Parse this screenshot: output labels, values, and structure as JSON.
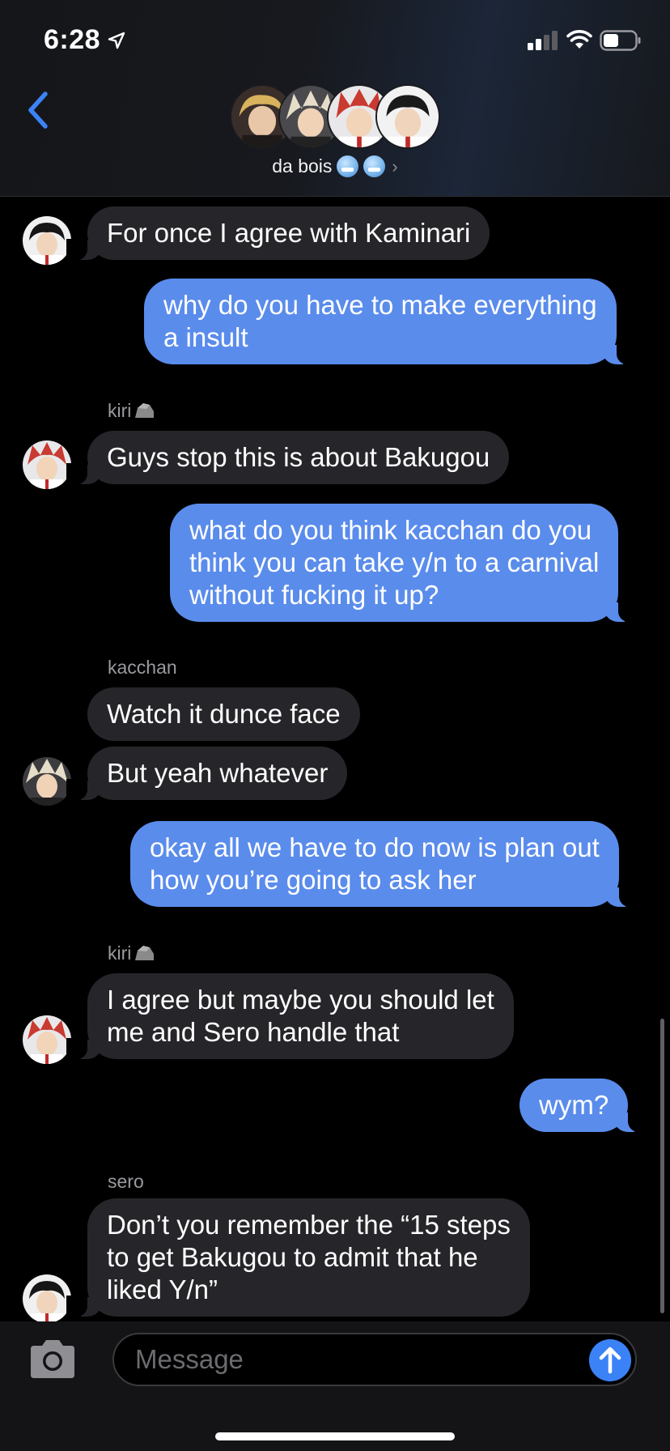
{
  "status_bar": {
    "time": "6:28"
  },
  "header": {
    "group_name": "da bois",
    "avatars": [
      "denki-avatar",
      "bakugou-avatar",
      "kirishima-avatar",
      "sero-avatar"
    ]
  },
  "messages": [
    {
      "id": "m1",
      "direction": "incoming",
      "sender": "",
      "text": "For once I agree with Kaminari",
      "avatar": "sero"
    },
    {
      "id": "m2",
      "direction": "outgoing",
      "lines": [
        "why do you have to make everything",
        "a insult"
      ]
    },
    {
      "id": "m3",
      "direction": "incoming",
      "sender": "kiri",
      "text": "Guys stop this is about Bakugou",
      "avatar": "kirishima"
    },
    {
      "id": "m4",
      "direction": "outgoing",
      "lines": [
        "what do you think kacchan do you",
        "think you can take y/n to a carnival",
        "without fucking it up?"
      ]
    },
    {
      "id": "m5",
      "direction": "incoming",
      "sender": "kacchan",
      "text": "Watch it dunce face"
    },
    {
      "id": "m6",
      "direction": "incoming",
      "sender": "",
      "text": "But yeah whatever",
      "avatar": "bakugou"
    },
    {
      "id": "m7",
      "direction": "outgoing",
      "lines": [
        "okay all we have to do now is plan out",
        "how you’re going to ask her"
      ]
    },
    {
      "id": "m8",
      "direction": "incoming",
      "sender": "kiri",
      "lines": [
        "I agree but maybe you should let",
        "me and Sero handle that"
      ],
      "avatar": "kirishima"
    },
    {
      "id": "m9",
      "direction": "outgoing",
      "text": "wym?"
    },
    {
      "id": "m10",
      "direction": "incoming",
      "sender": "sero",
      "lines": [
        "Don’t you remember the “15 steps",
        "to get Bakugou to admit that he",
        "liked Y/n”"
      ],
      "avatar": "sero"
    }
  ],
  "input": {
    "placeholder": "Message"
  },
  "colors": {
    "outgoing_bubble": "#5a8cec",
    "incoming_bubble": "#26262a",
    "accent": "#3b82f6",
    "sender_label": "#9a9aa0"
  }
}
